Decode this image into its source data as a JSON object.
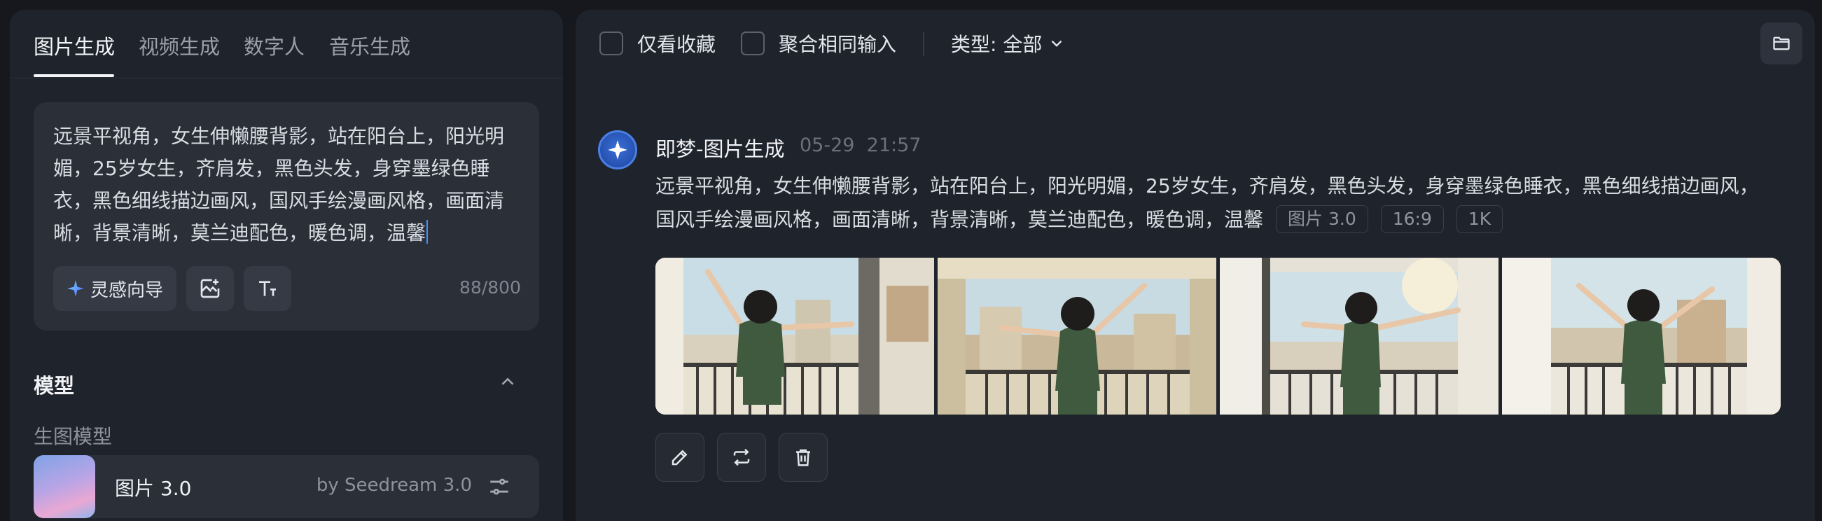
{
  "left_panel": {
    "tabs": [
      {
        "label": "图片生成",
        "active": true
      },
      {
        "label": "视频生成",
        "active": false
      },
      {
        "label": "数字人",
        "active": false
      },
      {
        "label": "音乐生成",
        "active": false
      }
    ],
    "prompt": {
      "text": "远景平视角，女生伸懒腰背影，站在阳台上，阳光明媚，25岁女生，齐肩发，黑色头发，身穿墨绿色睡衣，黑色细线描边画风，国风手绘漫画风格，画面清晰，背景清晰，莫兰迪配色，暖色调，温馨",
      "char_count": "88/800",
      "inspiration_label": "灵感向导"
    },
    "model_section": {
      "title": "模型",
      "sub_label": "生图模型",
      "model_name": "图片 3.0",
      "model_by": "by Seedream 3.0"
    }
  },
  "right_panel": {
    "filters": {
      "favorites_label": "仅看收藏",
      "merge_label": "聚合相同输入",
      "type_label": "类型: 全部"
    },
    "generation": {
      "title": "即梦-图片生成",
      "date": "05-29",
      "time": "21:57",
      "prompt": "远景平视角，女生伸懒腰背影，站在阳台上，阳光明媚，25岁女生，齐肩发，黑色头发，身穿墨绿色睡衣，黑色细线描边画风，国风手绘漫画风格，画面清晰，背景清晰，莫兰迪配色，暖色调，温馨",
      "tags": [
        "图片 3.0",
        "16:9",
        "1K"
      ],
      "image_count": 4
    }
  },
  "colors": {
    "background": "#16181d",
    "panel": "#1f232b",
    "accent_blue": "#4a8cff",
    "pajama_green": "#3f5a3e"
  }
}
